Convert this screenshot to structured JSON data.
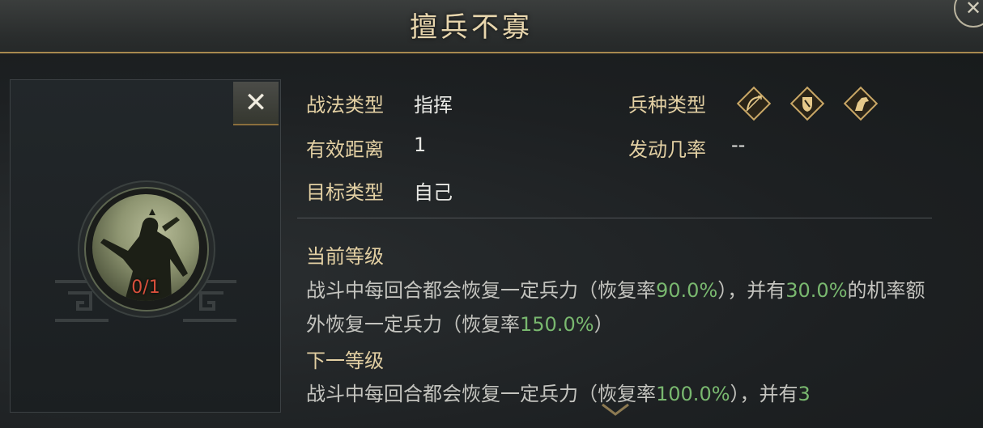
{
  "header": {
    "title": "擅兵不寡"
  },
  "left": {
    "close_label": "✕",
    "level_counter": "0/1"
  },
  "info": {
    "tactic_type_label": "战法类型",
    "tactic_type_value": "指挥",
    "range_label": "有效距离",
    "range_value": "1",
    "target_label": "目标类型",
    "target_value": "自己",
    "troop_label": "兵种类型",
    "troop_icons": [
      "bow-icon",
      "shield-icon",
      "horse-icon"
    ],
    "chance_label": "发动几率",
    "chance_value": "--"
  },
  "current": {
    "title": "当前等级",
    "p1": "战斗中每回合都会恢复一定兵力（恢复率",
    "v1": "90.0%",
    "p2": "），并有",
    "v2": "30.0%",
    "p3": "的机率额外恢复一定兵力（恢复率",
    "v3": "150.0%",
    "p4": "）"
  },
  "next": {
    "title": "下一等级",
    "p1": "战斗中每回合都会恢复一定兵力（恢复率",
    "v1": "100.0%",
    "p2": "），并有",
    "v2": "3"
  },
  "colors": {
    "gold": "#e3d0a3",
    "highlight_green": "#79b86f",
    "counter_red": "#d8503c"
  }
}
